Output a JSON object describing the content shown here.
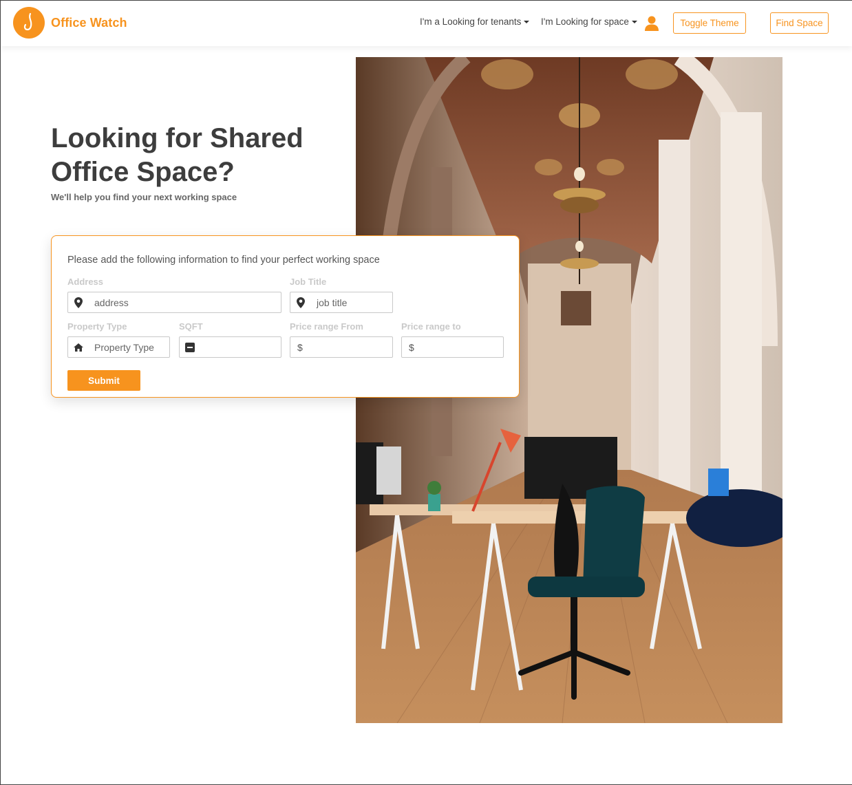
{
  "brand": {
    "name": "Office Watch",
    "accent_color": "#f7931e"
  },
  "nav": {
    "tenants_label": "I'm a Looking for tenants",
    "space_label": "I'm Looking for space",
    "toggle_theme_label": "Toggle Theme",
    "find_space_label": "Find Space",
    "user_icon": "user-icon"
  },
  "hero": {
    "title_line1": "Looking for Shared",
    "title_line2": "Office Space?",
    "subtitle": "We'll help you find your next working space",
    "image": "office-interior-photo"
  },
  "form": {
    "intro": "Please add the following information to find your perfect working space",
    "address": {
      "label": "Address",
      "placeholder": "address",
      "icon": "map-pin-icon"
    },
    "job_title": {
      "label": "Job Title",
      "placeholder": "job title",
      "icon": "map-pin-icon"
    },
    "property_type": {
      "label": "Property Type",
      "placeholder": "Property Type",
      "icon": "home-icon"
    },
    "sqft": {
      "label": "SQFT",
      "placeholder": "",
      "icon": "minus-square-icon"
    },
    "price_from": {
      "label": "Price range From",
      "prefix": "$"
    },
    "price_to": {
      "label": "Price range to",
      "prefix": "$"
    },
    "submit_label": "Submit"
  }
}
